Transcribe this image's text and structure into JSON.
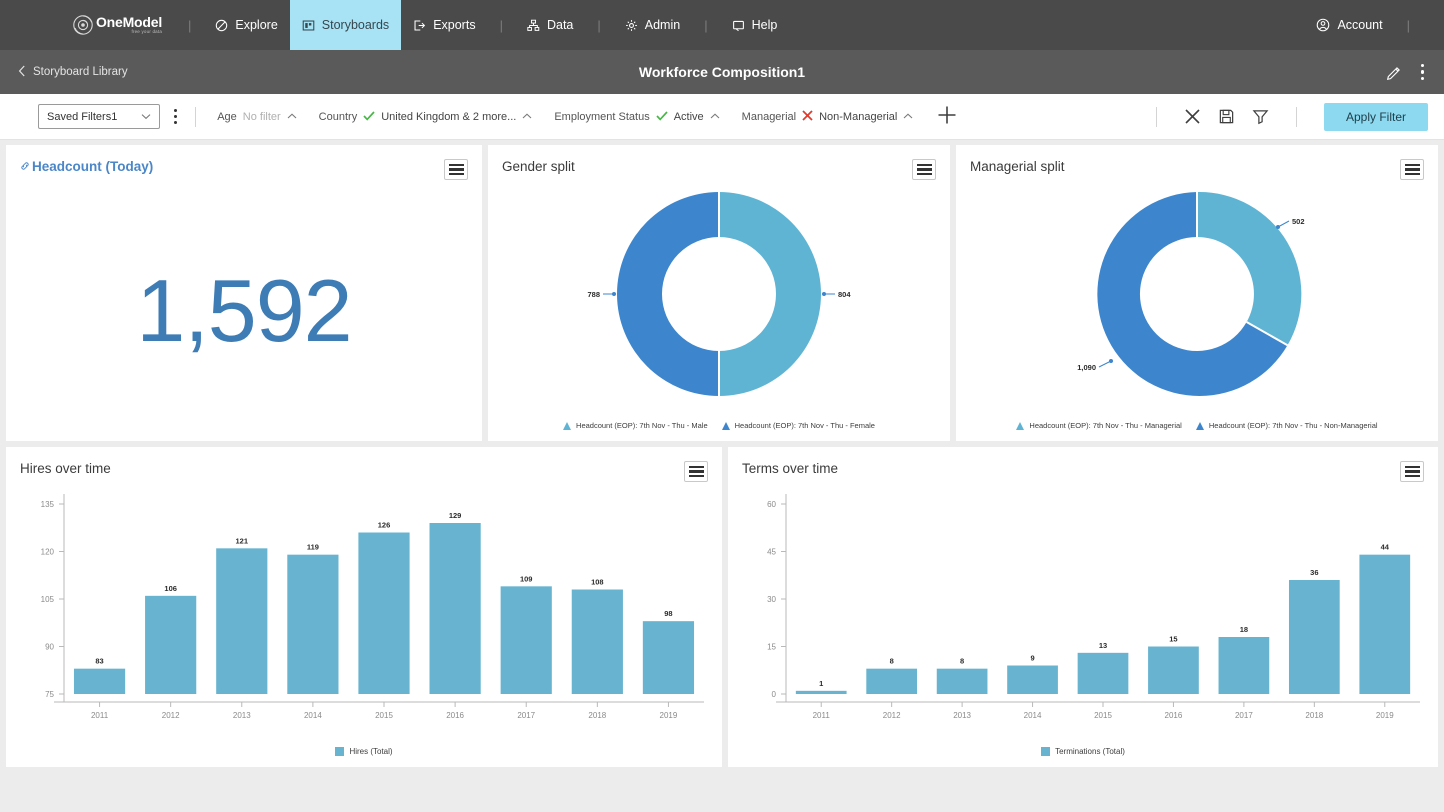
{
  "topnav": {
    "logo": {
      "name": "OneModel",
      "tagline": "free your data"
    },
    "items": [
      {
        "label": "Explore",
        "icon": "explore-icon",
        "active": false
      },
      {
        "label": "Storyboards",
        "icon": "storyboards-icon",
        "active": true
      },
      {
        "label": "Exports",
        "icon": "exports-icon",
        "active": false
      },
      {
        "label": "Data",
        "icon": "data-icon",
        "active": false
      },
      {
        "label": "Admin",
        "icon": "admin-gear-icon",
        "active": false
      },
      {
        "label": "Help",
        "icon": "help-icon",
        "active": false
      }
    ],
    "account": {
      "label": "Account",
      "icon": "account-avatar-icon"
    },
    "active_color": "#a8e3f5",
    "bg_color": "#4a4a4a"
  },
  "subheader": {
    "back_label": "Storyboard Library",
    "title": "Workforce Composition1",
    "edit_icon": "pencil-icon",
    "more_icon": "kebab-menu-icon"
  },
  "filterbar": {
    "saved_filter": {
      "value": "Saved Filters1",
      "caret": "chevron-down-icon"
    },
    "more_icon": "kebab-menu-icon",
    "chips": [
      {
        "label": "Age",
        "status": "none",
        "value": "No filter",
        "caret": "chevron-up-icon"
      },
      {
        "label": "Country",
        "status": "include",
        "value": "United Kingdom & 2 more...",
        "caret": "chevron-up-icon"
      },
      {
        "label": "Employment Status",
        "status": "include",
        "value": "Active",
        "caret": "chevron-up-icon"
      },
      {
        "label": "Managerial",
        "status": "exclude",
        "value": "Non-Managerial",
        "caret": "chevron-up-icon"
      }
    ],
    "add_icon": "plus-icon",
    "actions": [
      {
        "icon": "close-x-icon",
        "name": "clear-filters"
      },
      {
        "icon": "save-disk-icon",
        "name": "save-filters"
      },
      {
        "icon": "funnel-icon",
        "name": "filter-options"
      }
    ],
    "apply_label": "Apply Filter",
    "apply_color": "#8dd9ef",
    "include_color": "#49b748",
    "exclude_color": "#e03b2f"
  },
  "panels": {
    "headcount": {
      "title": "Headcount (Today)",
      "link_icon": "link-icon",
      "value": "1,592",
      "value_color": "#3d7cb5",
      "menu_icon": "hamburger-menu-icon"
    },
    "gender": {
      "title": "Gender split",
      "menu_icon": "hamburger-menu-icon"
    },
    "managerial": {
      "title": "Managerial split",
      "menu_icon": "hamburger-menu-icon"
    },
    "hires": {
      "title": "Hires over time",
      "menu_icon": "hamburger-menu-icon"
    },
    "terms": {
      "title": "Terms over time",
      "menu_icon": "hamburger-menu-icon"
    }
  },
  "chart_data": [
    {
      "id": "gender-split",
      "type": "pie",
      "title": "Gender split",
      "labels": [
        "Headcount (EOP): 7th Nov - Thu - Male",
        "Headcount (EOP): 7th Nov - Thu - Female"
      ],
      "values": [
        804,
        788
      ],
      "colors": [
        "#5fb4d4",
        "#3d86cd"
      ],
      "donut": true,
      "legend_position": "bottom",
      "data_labels": [
        "804",
        "788"
      ]
    },
    {
      "id": "managerial-split",
      "type": "pie",
      "title": "Managerial split",
      "labels": [
        "Headcount (EOP): 7th Nov - Thu - Managerial",
        "Headcount (EOP): 7th Nov - Thu - Non-Managerial"
      ],
      "values": [
        502,
        1090
      ],
      "colors": [
        "#5fb4d4",
        "#3d86cd"
      ],
      "donut": true,
      "legend_position": "bottom",
      "data_labels": [
        "502",
        "1,090"
      ]
    },
    {
      "id": "hires-over-time",
      "type": "bar",
      "title": "Hires over time",
      "categories": [
        "2011",
        "2012",
        "2013",
        "2014",
        "2015",
        "2016",
        "2017",
        "2018",
        "2019"
      ],
      "values": [
        83,
        106,
        121,
        119,
        126,
        129,
        109,
        108,
        98
      ],
      "series": [
        {
          "name": "Hires (Total)",
          "values": [
            83,
            106,
            121,
            119,
            126,
            129,
            109,
            108,
            98
          ]
        }
      ],
      "yticks": [
        75,
        90,
        105,
        120,
        135
      ],
      "ylim": [
        75,
        135
      ],
      "xlabel": "",
      "ylabel": "",
      "grid": false,
      "legend": [
        "Hires (Total)"
      ],
      "legend_position": "bottom",
      "color": "#68b4d0"
    },
    {
      "id": "terms-over-time",
      "type": "bar",
      "title": "Terms over time",
      "categories": [
        "2011",
        "2012",
        "2013",
        "2014",
        "2015",
        "2016",
        "2017",
        "2018",
        "2019"
      ],
      "values": [
        1,
        8,
        8,
        9,
        13,
        15,
        18,
        36,
        44
      ],
      "series": [
        {
          "name": "Terminations (Total)",
          "values": [
            1,
            8,
            8,
            9,
            13,
            15,
            18,
            36,
            44
          ]
        }
      ],
      "yticks": [
        0,
        15,
        30,
        45,
        60
      ],
      "ylim": [
        0,
        60
      ],
      "xlabel": "",
      "ylabel": "",
      "grid": false,
      "legend": [
        "Terminations (Total)"
      ],
      "legend_position": "bottom",
      "color": "#68b4d0"
    }
  ]
}
